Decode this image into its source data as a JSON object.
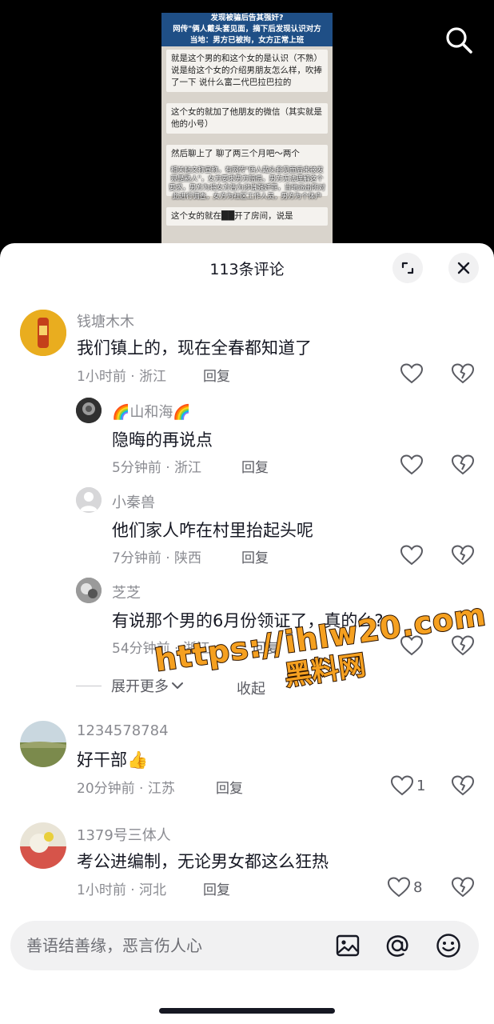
{
  "video": {
    "banner_line1": "发现被骗后告其强奸?",
    "banner_line2": "网传\"俩人戴头套见面，摘下后发现认识对方",
    "banner_line3": "当地：男方已被拘，女方正常上班",
    "card1": "就是这个男的和这个女的是认识（不熟）说是给这个女的介绍男朋友怎么样，吹捧了一下 说什么富二代巴拉巴拉的",
    "card2": "这个女的就加了他朋友的微信（其实就是他的小号）",
    "card3": "然后聊上了 聊了两三个月吧～两个",
    "overlay": "相关帖文称宣称，有网传\"俩人戴头套见面后来被发现是熟人\"，女方要求男方赔偿，男方无法理解这个要求，男方为将女方告为涉嫌强奸罪，当地派出所对此进行调查，女方为社区工作人员，男方为个体户",
    "card4": "这个女的就在██开了房间，说是"
  },
  "sheet": {
    "title": "113条评论"
  },
  "comments": [
    {
      "name": "钱塘木木",
      "text": "我们镇上的，现在全春都知道了",
      "meta": "1小时前 · 浙江",
      "reply": "回复",
      "likes": ""
    },
    {
      "name": "🌈山和海🌈",
      "text": "隐晦的再说点",
      "meta": "5分钟前 · 浙江",
      "reply": "回复",
      "likes": ""
    },
    {
      "name": "小秦兽",
      "text": "他们家人咋在村里抬起头呢",
      "meta": "7分钟前 · 陕西",
      "reply": "回复",
      "likes": ""
    },
    {
      "name": "芝芝",
      "text": "有说那个男的6月份领证了，真的么?",
      "meta": "54分钟前 · 浙江",
      "reply": "回复",
      "likes": ""
    },
    {
      "name": "1234578784",
      "text": "好干部👍",
      "meta": "20分钟前 · 江苏",
      "reply": "回复",
      "likes": "1"
    },
    {
      "name": "1379号三体人",
      "text": "考公进编制，无论男女都这么狂热",
      "meta": "1小时前 · 河北",
      "reply": "回复",
      "likes": "8"
    }
  ],
  "expand": {
    "more": "展开更多",
    "collapse": "收起"
  },
  "input": {
    "placeholder": "善语结善缘，恶言伤人心"
  },
  "watermark": {
    "line1": "https://ihlw20.com",
    "line2": "黑料网"
  },
  "colors": {
    "text": "#161823",
    "secondary": "#8a8b91",
    "background": "#ffffff",
    "input_bg": "#f1f1f2",
    "watermark": "#f5a020"
  }
}
